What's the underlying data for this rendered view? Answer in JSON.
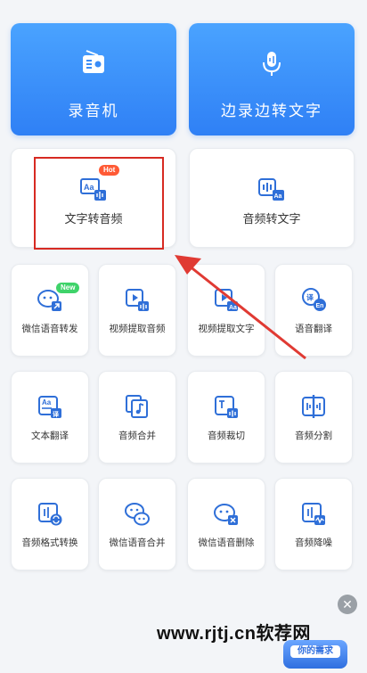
{
  "top_cards": [
    {
      "label": "录音机",
      "icon": "radio-icon"
    },
    {
      "label": "边录边转文字",
      "icon": "microphone-icon"
    }
  ],
  "row2": [
    {
      "label": "文字转音频",
      "icon": "text-to-audio-icon",
      "badge": "Hot"
    },
    {
      "label": "音频转文字",
      "icon": "audio-to-text-icon"
    }
  ],
  "grid": [
    {
      "label": "微信语音转发",
      "icon": "wechat-forward-icon",
      "badge": "New"
    },
    {
      "label": "视频提取音频",
      "icon": "video-extract-audio-icon"
    },
    {
      "label": "视频提取文字",
      "icon": "video-extract-text-icon"
    },
    {
      "label": "语音翻译",
      "icon": "voice-translate-icon"
    },
    {
      "label": "文本翻译",
      "icon": "text-translate-icon"
    },
    {
      "label": "音频合并",
      "icon": "audio-merge-icon"
    },
    {
      "label": "音频裁切",
      "icon": "audio-cut-icon"
    },
    {
      "label": "音频分割",
      "icon": "audio-split-icon"
    },
    {
      "label": "音频格式转换",
      "icon": "audio-format-icon"
    },
    {
      "label": "微信语音合并",
      "icon": "wechat-merge-icon"
    },
    {
      "label": "微信语音删除",
      "icon": "wechat-delete-icon"
    },
    {
      "label": "音频降噪",
      "icon": "audio-denoise-icon"
    }
  ],
  "watermark": "www.rjtj.cn软荐网",
  "promo": {
    "label": "你的需求"
  },
  "colors": {
    "accent": "#2f80f5",
    "highlight": "#d72a22",
    "hot": "#ff5a35",
    "new": "#3fd36a"
  }
}
